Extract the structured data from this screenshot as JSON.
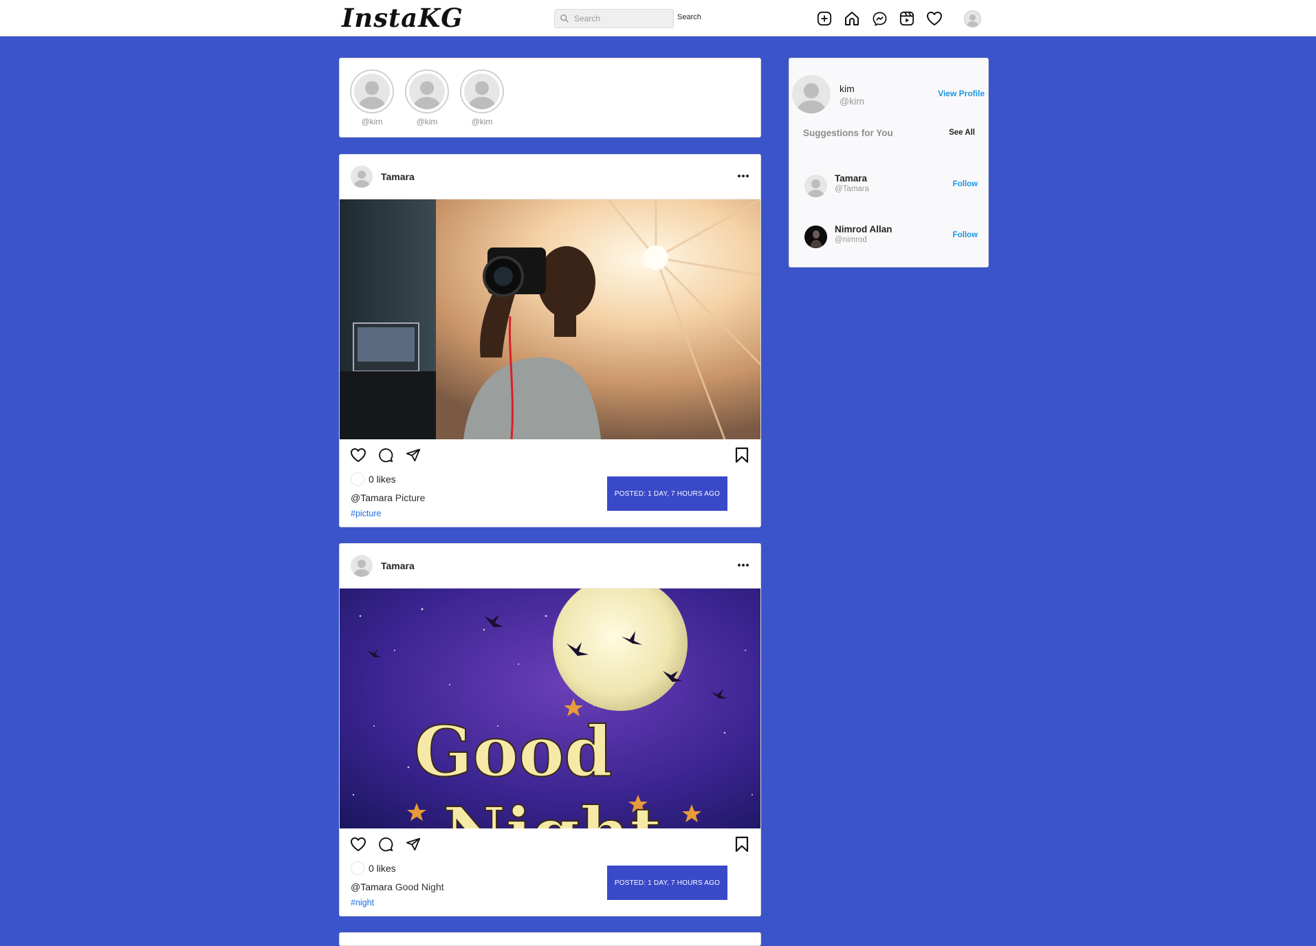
{
  "app": {
    "logo": "InstaKG"
  },
  "navbar": {
    "search_placeholder": "Search",
    "search_button": "Search",
    "icons": [
      "create-icon",
      "home-icon",
      "messenger-icon",
      "reels-icon",
      "heart-icon"
    ]
  },
  "stories": [
    {
      "handle": "@kim"
    },
    {
      "handle": "@kim"
    },
    {
      "handle": "@kim"
    }
  ],
  "posts": [
    {
      "author": "Tamara",
      "likes": "0 likes",
      "caption_user": "@Tamara",
      "caption_text": " Picture",
      "hashtag": "#picture",
      "posted": "POSTED: 1 DAY, 7 HOURS AGO"
    },
    {
      "author": "Tamara",
      "likes": "0 likes",
      "caption_user": "@Tamara",
      "caption_text": " Good Night",
      "hashtag": "#night",
      "posted": "POSTED: 1 DAY, 7 HOURS AGO",
      "image_text_1": "Good",
      "image_text_2": "Night"
    }
  ],
  "sidebar": {
    "name": "kim",
    "handle": "@kim",
    "view_profile": "View Profile",
    "suggestions_title": "Suggestions for You",
    "see_all": "See All",
    "suggestions": [
      {
        "name": "Tamara",
        "handle": "@Tamara",
        "action": "Follow"
      },
      {
        "name": "Nimrod Allan",
        "handle": "@nimrod",
        "action": "Follow"
      }
    ]
  },
  "colors": {
    "page_background": "#3b54c9",
    "accent_blue": "#1b95e0",
    "posted_badge": "#3949c7",
    "hashtag": "#1f6ce0"
  }
}
